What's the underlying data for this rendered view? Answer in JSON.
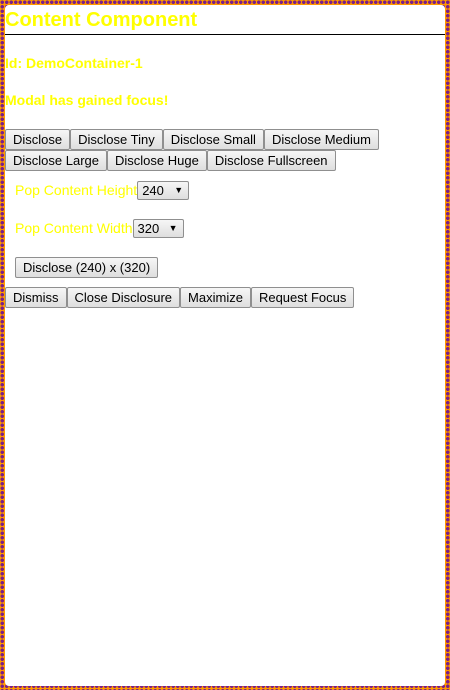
{
  "header": {
    "title": "Content Component"
  },
  "info": {
    "id_line": "Id: DemoContainer-1",
    "focus_line": "Modal has gained focus!"
  },
  "disclose_buttons": [
    "Disclose",
    "Disclose Tiny",
    "Disclose Small",
    "Disclose Medium",
    "Disclose Large",
    "Disclose Huge",
    "Disclose Fullscreen"
  ],
  "pop_content": {
    "height_label": "Pop Content Height",
    "height_value": "240",
    "width_label": "Pop Content Width",
    "width_value": "320",
    "disclose_size_label": "Disclose (240) x (320)"
  },
  "action_buttons": [
    "Dismiss",
    "Close Disclosure",
    "Maximize",
    "Request Focus"
  ],
  "colors": {
    "text_accent": "#ffff00",
    "frame_dot": "#7a1f8a",
    "frame_bg": "#ff9900"
  }
}
